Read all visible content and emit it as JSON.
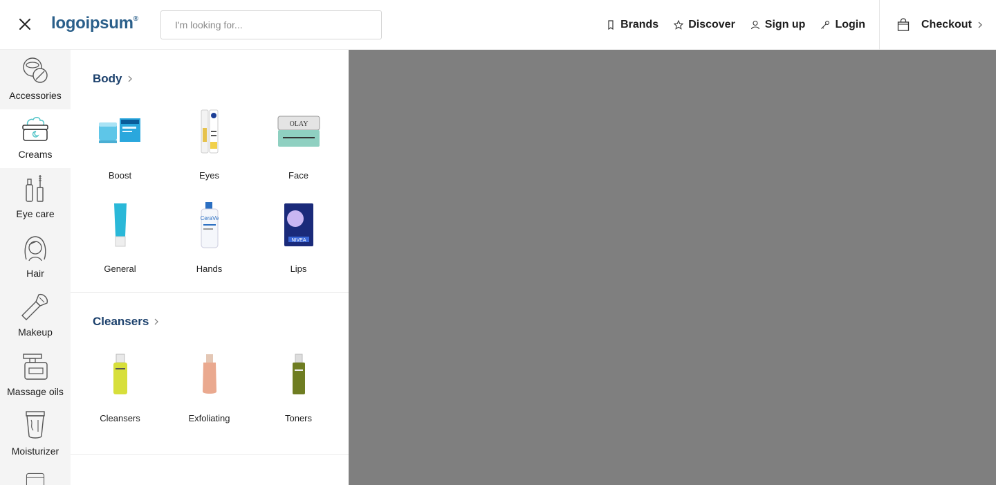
{
  "header": {
    "logo_text": "logoipsum",
    "logo_mark": "®",
    "search_placeholder": "I'm looking for...",
    "nav": [
      {
        "label": "Brands",
        "icon": "tag-icon"
      },
      {
        "label": "Discover",
        "icon": "star-icon"
      },
      {
        "label": "Sign up",
        "icon": "user-icon"
      },
      {
        "label": "Login",
        "icon": "key-icon"
      }
    ],
    "checkout_label": "Checkout"
  },
  "rail": {
    "items": [
      {
        "label": "Accessories",
        "icon": "accessories-icon",
        "active": false
      },
      {
        "label": "Creams",
        "icon": "cream-jar-icon",
        "active": true
      },
      {
        "label": "Eye care",
        "icon": "eye-care-icon",
        "active": false
      },
      {
        "label": "Hair",
        "icon": "hair-icon",
        "active": false
      },
      {
        "label": "Makeup",
        "icon": "makeup-brush-icon",
        "active": false
      },
      {
        "label": "Massage oils",
        "icon": "massage-oil-icon",
        "active": false
      },
      {
        "label": "Moisturizer",
        "icon": "moisturizer-icon",
        "active": false
      }
    ]
  },
  "panel": {
    "sections": [
      {
        "title": "Body",
        "products": [
          "Boost",
          "Eyes",
          "Face",
          "General",
          "Hands",
          "Lips"
        ]
      },
      {
        "title": "Cleansers",
        "products": [
          "Cleansers",
          "Exfoliating",
          "Toners"
        ]
      }
    ]
  },
  "colors": {
    "brand": "#2a5f8a",
    "section_title": "#1a3f6b",
    "overlay": "#7f7f7f",
    "rail_bg": "#f4f4f4",
    "accent_teal": "#4fc3c7"
  }
}
